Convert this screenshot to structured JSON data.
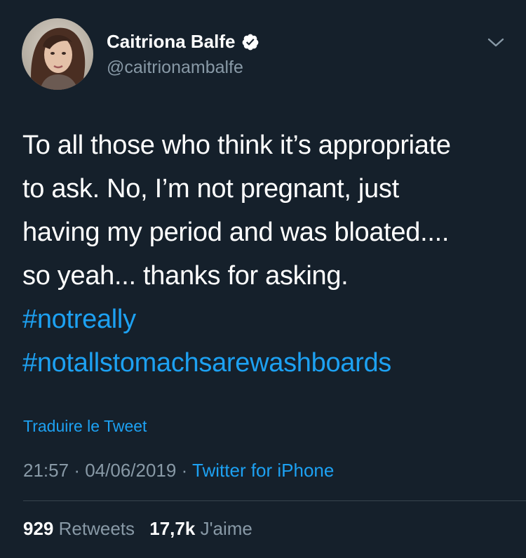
{
  "user": {
    "display_name": "Caitriona Balfe",
    "handle": "@caitrionambalfe",
    "avatar_icon": "profile-photo",
    "verified_icon": "verified-badge-icon"
  },
  "menu_icon": "chevron-down-icon",
  "tweet": {
    "lines": [
      "To all those who think it’s appropriate",
      "to ask. No, I’m not pregnant, just",
      "having my period and was bloated....",
      "so yeah... thanks for asking."
    ],
    "hashtags": [
      "#notreally",
      "#notallstomachsarewashboards"
    ]
  },
  "translate_label": "Traduire le Tweet",
  "meta": {
    "time": "21:57",
    "separator": "·",
    "date": "04/06/2019",
    "source": "Twitter for iPhone"
  },
  "stats": {
    "retweets_count": "929",
    "retweets_label": "Retweets",
    "likes_count": "17,7k",
    "likes_label": "J'aime"
  },
  "colors": {
    "background": "#15202b",
    "accent": "#1da1f2",
    "secondary_text": "#8899a6",
    "divider": "#38444d"
  }
}
